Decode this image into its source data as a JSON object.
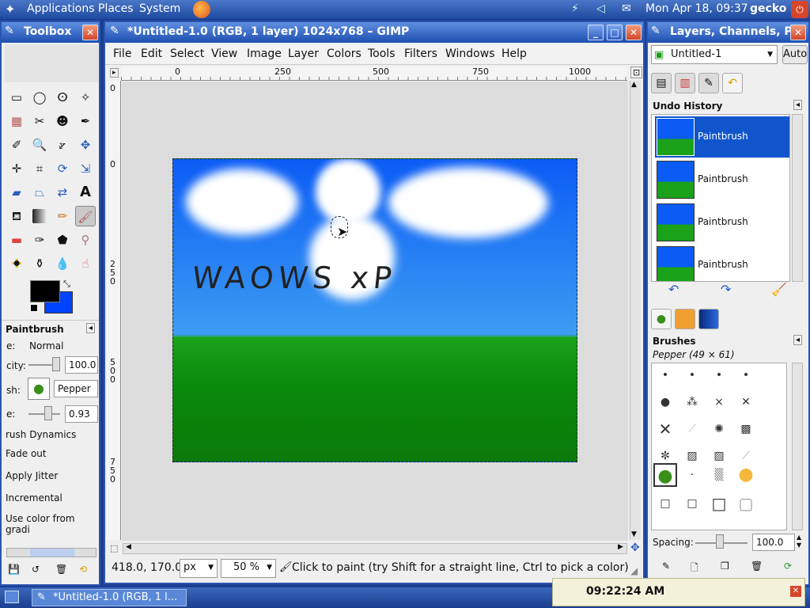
{
  "top_panel": {
    "menus": [
      "Applications",
      "Places",
      "System"
    ],
    "clock": "Mon Apr 18, 09:37",
    "user": "gecko"
  },
  "toolbox": {
    "title": "Toolbox",
    "options_title": "Paintbrush",
    "mode_label": "e:",
    "mode_value": "Normal",
    "opacity_label": "city:",
    "opacity_value": "100.0",
    "brush_label": "sh:",
    "brush_value": "Pepper",
    "scale_label": "e:",
    "scale_value": "0.93",
    "dynamics": "rush Dynamics",
    "fade_out": "Fade out",
    "apply_jitter": "Apply Jitter",
    "incremental": "Incremental",
    "use_color": "Use color from gradi"
  },
  "image_window": {
    "title": "*Untitled-1.0 (RGB, 1 layer) 1024x768 – GIMP",
    "menu": [
      "File",
      "Edit",
      "Select",
      "View",
      "Image",
      "Layer",
      "Colors",
      "Tools",
      "Filters",
      "Windows",
      "Help"
    ],
    "ruler_h": [
      "0",
      "250",
      "500",
      "750",
      "1000"
    ],
    "ruler_v": [
      "0",
      "2\n5\n0",
      "5\n0\n0",
      "7\n5\n0"
    ],
    "canvas_text": "WAOWS xP",
    "coords": "418.0, 170.0",
    "unit": "px",
    "zoom": "50 %",
    "status": "Click to paint (try Shift for a straight line, Ctrl to pick a color)"
  },
  "layers_window": {
    "title": "Layers, Channels, P",
    "image_select": "Untitled-1",
    "auto_button": "Auto",
    "undo_title": "Undo History",
    "undo_items": [
      "Paintbrush",
      "Paintbrush",
      "Paintbrush",
      "Paintbrush"
    ],
    "brushes_title": "Brushes",
    "brush_name": "Pepper (49 × 61)",
    "spacing_label": "Spacing:",
    "spacing_value": "100.0"
  },
  "taskbar": {
    "task": "*Untitled-1.0 (RGB, 1 l...",
    "clock_time": "09:22:24 AM"
  },
  "colors": {
    "fg": "#000000",
    "bg": "#0044ff",
    "accent": "#1f4fb0",
    "selection": "#1155cc"
  }
}
